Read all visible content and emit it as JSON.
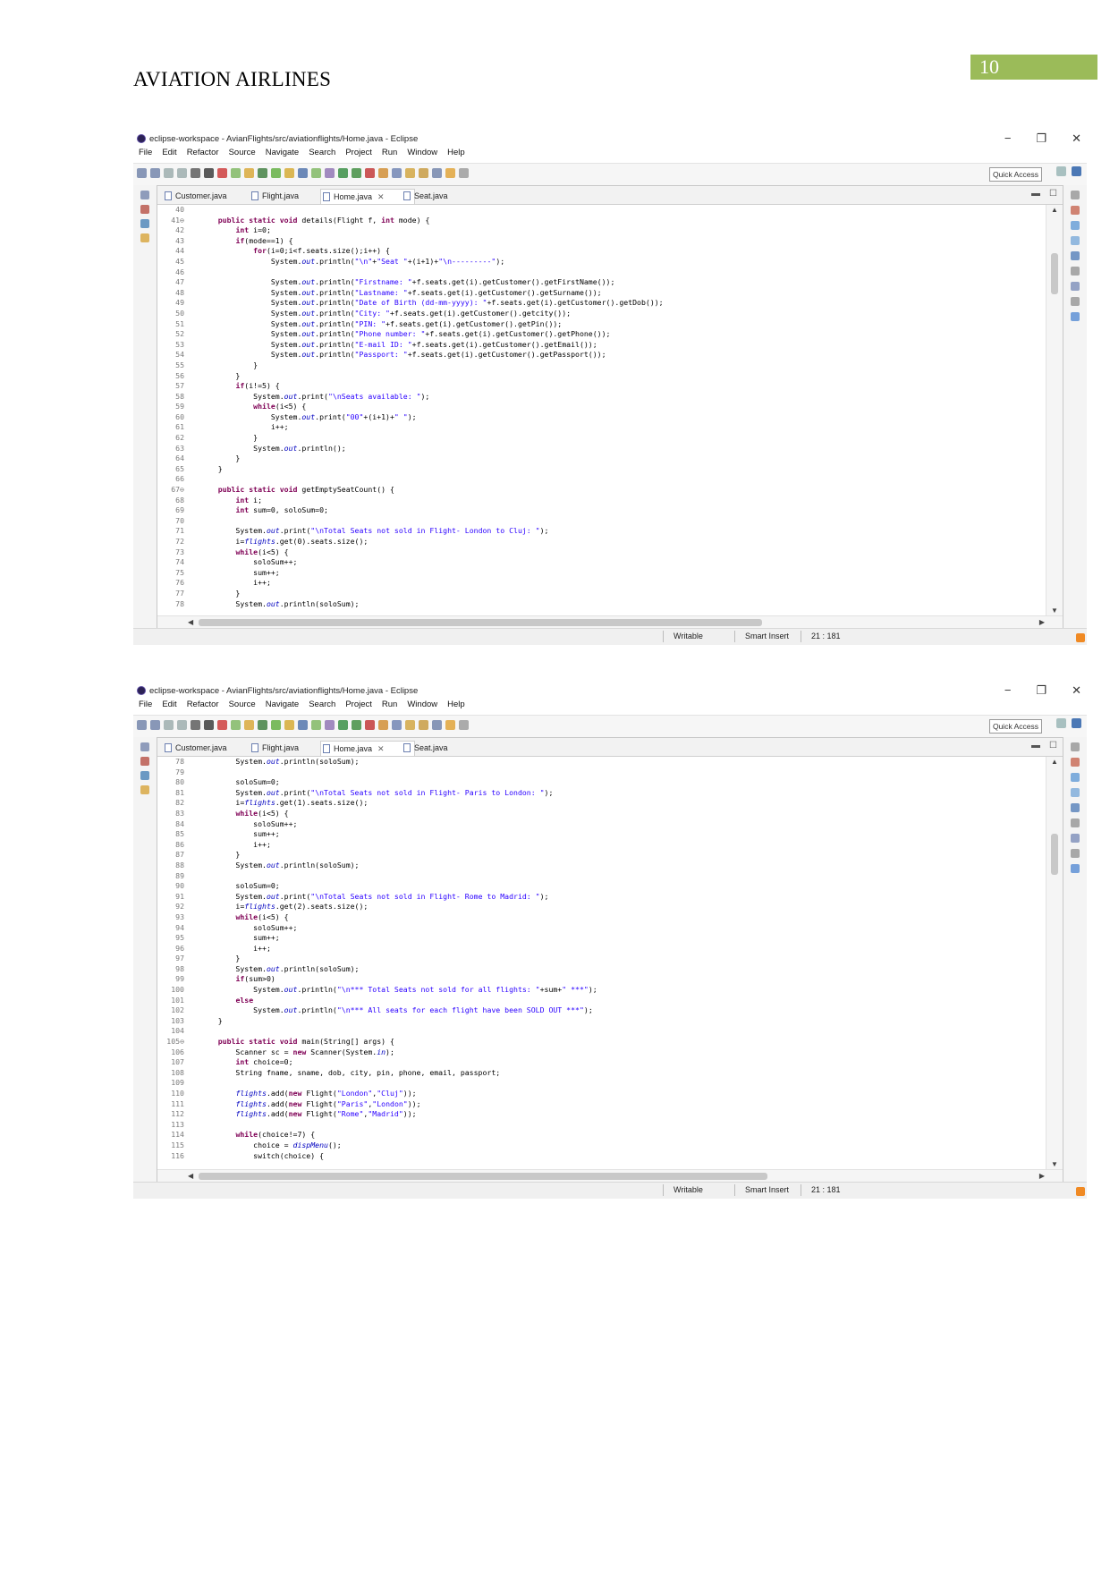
{
  "document": {
    "title": "AVIATION AIRLINES",
    "page_number": "10"
  },
  "screenshots": [
    {
      "window_title": "eclipse-workspace - AvianFlights/src/aviationflights/Home.java - Eclipse",
      "window_buttons": [
        "−",
        "❐",
        "✕"
      ],
      "menu": [
        "File",
        "Edit",
        "Refactor",
        "Source",
        "Navigate",
        "Search",
        "Project",
        "Run",
        "Window",
        "Help"
      ],
      "quick_access": "Quick Access",
      "tabs": [
        {
          "label": "Customer.java",
          "active": false
        },
        {
          "label": "Flight.java",
          "active": false
        },
        {
          "label": "Home.java",
          "active": true
        },
        {
          "label": "Seat.java",
          "active": false
        }
      ],
      "code": [
        {
          "n": "40",
          "t": ""
        },
        {
          "n": "41⊖",
          "t": "    <kw>public</kw> <kw>static</kw> <kw>void</kw> details(Flight f, <kw>int</kw> mode) {"
        },
        {
          "n": "42",
          "t": "        <kw>int</kw> i=0;"
        },
        {
          "n": "43",
          "t": "        <kw>if</kw>(mode==1) {"
        },
        {
          "n": "44",
          "t": "            <kw>for</kw>(i=0;i<f.seats.size();i++) {"
        },
        {
          "n": "45",
          "t": "                System.<fld>out</fld>.println(<str>\"\\n\"</str>+<str>\"Seat \"</str>+(i+1)+<str>\"\\n---------\"</str>);"
        },
        {
          "n": "46",
          "t": ""
        },
        {
          "n": "47",
          "t": "                System.<fld>out</fld>.println(<str>\"Firstname: \"</str>+f.seats.get(i).getCustomer().getFirstName());"
        },
        {
          "n": "48",
          "t": "                System.<fld>out</fld>.println(<str>\"Lastname: \"</str>+f.seats.get(i).getCustomer().getSurname());"
        },
        {
          "n": "49",
          "t": "                System.<fld>out</fld>.println(<str>\"Date of Birth (dd-mm-yyyy): \"</str>+f.seats.get(i).getCustomer().getDob());"
        },
        {
          "n": "50",
          "t": "                System.<fld>out</fld>.println(<str>\"City: \"</str>+f.seats.get(i).getCustomer().getcity());"
        },
        {
          "n": "51",
          "t": "                System.<fld>out</fld>.println(<str>\"PIN: \"</str>+f.seats.get(i).getCustomer().getPin());"
        },
        {
          "n": "52",
          "t": "                System.<fld>out</fld>.println(<str>\"Phone number: \"</str>+f.seats.get(i).getCustomer().getPhone());"
        },
        {
          "n": "53",
          "t": "                System.<fld>out</fld>.println(<str>\"E-mail ID: \"</str>+f.seats.get(i).getCustomer().getEmail());"
        },
        {
          "n": "54",
          "t": "                System.<fld>out</fld>.println(<str>\"Passport: \"</str>+f.seats.get(i).getCustomer().getPassport());"
        },
        {
          "n": "55",
          "t": "            }"
        },
        {
          "n": "56",
          "t": "        }"
        },
        {
          "n": "57",
          "t": "        <kw>if</kw>(i!=5) {"
        },
        {
          "n": "58",
          "t": "            System.<fld>out</fld>.print(<str>\"\\nSeats available: \"</str>);"
        },
        {
          "n": "59",
          "t": "            <kw>while</kw>(i<5) {"
        },
        {
          "n": "60",
          "t": "                System.<fld>out</fld>.print(<str>\"00\"</str>+(i+1)+<str>\" \"</str>);"
        },
        {
          "n": "61",
          "t": "                i++;"
        },
        {
          "n": "62",
          "t": "            }"
        },
        {
          "n": "63",
          "t": "            System.<fld>out</fld>.println();"
        },
        {
          "n": "64",
          "t": "        }"
        },
        {
          "n": "65",
          "t": "    }"
        },
        {
          "n": "66",
          "t": ""
        },
        {
          "n": "67⊖",
          "t": "    <kw>public</kw> <kw>static</kw> <kw>void</kw> getEmptySeatCount() {"
        },
        {
          "n": "68",
          "t": "        <kw>int</kw> i;"
        },
        {
          "n": "69",
          "t": "        <kw>int</kw> sum=0, soloSum=0;"
        },
        {
          "n": "70",
          "t": ""
        },
        {
          "n": "71",
          "t": "        System.<fld>out</fld>.print(<str>\"\\nTotal Seats not sold in Flight- London to Cluj: \"</str>);"
        },
        {
          "n": "72",
          "t": "        i=<fld>flights</fld>.get(0).seats.size();"
        },
        {
          "n": "73",
          "t": "        <kw>while</kw>(i<5) {"
        },
        {
          "n": "74",
          "t": "            soloSum++;"
        },
        {
          "n": "75",
          "t": "            sum++;"
        },
        {
          "n": "76",
          "t": "            i++;"
        },
        {
          "n": "77",
          "t": "        }"
        },
        {
          "n": "78",
          "t": "        System.<fld>out</fld>.println(soloSum);"
        }
      ],
      "status": {
        "writable": "Writable",
        "insert": "Smart Insert",
        "position": "21 : 181"
      }
    },
    {
      "window_title": "eclipse-workspace - AvianFlights/src/aviationflights/Home.java - Eclipse",
      "window_buttons": [
        "−",
        "❐",
        "✕"
      ],
      "menu": [
        "File",
        "Edit",
        "Refactor",
        "Source",
        "Navigate",
        "Search",
        "Project",
        "Run",
        "Window",
        "Help"
      ],
      "quick_access": "Quick Access",
      "tabs": [
        {
          "label": "Customer.java",
          "active": false
        },
        {
          "label": "Flight.java",
          "active": false
        },
        {
          "label": "Home.java",
          "active": true
        },
        {
          "label": "Seat.java",
          "active": false
        }
      ],
      "code": [
        {
          "n": "78",
          "t": "        System.<fld>out</fld>.println(soloSum);"
        },
        {
          "n": "79",
          "t": ""
        },
        {
          "n": "80",
          "t": "        soloSum=0;"
        },
        {
          "n": "81",
          "t": "        System.<fld>out</fld>.print(<str>\"\\nTotal Seats not sold in Flight- Paris to London: \"</str>);"
        },
        {
          "n": "82",
          "t": "        i=<fld>flights</fld>.get(1).seats.size();"
        },
        {
          "n": "83",
          "t": "        <kw>while</kw>(i<5) {"
        },
        {
          "n": "84",
          "t": "            soloSum++;"
        },
        {
          "n": "85",
          "t": "            sum++;"
        },
        {
          "n": "86",
          "t": "            i++;"
        },
        {
          "n": "87",
          "t": "        }"
        },
        {
          "n": "88",
          "t": "        System.<fld>out</fld>.println(soloSum);"
        },
        {
          "n": "89",
          "t": ""
        },
        {
          "n": "90",
          "t": "        soloSum=0;"
        },
        {
          "n": "91",
          "t": "        System.<fld>out</fld>.print(<str>\"\\nTotal Seats not sold in Flight- Rome to Madrid: \"</str>);"
        },
        {
          "n": "92",
          "t": "        i=<fld>flights</fld>.get(2).seats.size();"
        },
        {
          "n": "93",
          "t": "        <kw>while</kw>(i<5) {"
        },
        {
          "n": "94",
          "t": "            soloSum++;"
        },
        {
          "n": "95",
          "t": "            sum++;"
        },
        {
          "n": "96",
          "t": "            i++;"
        },
        {
          "n": "97",
          "t": "        }"
        },
        {
          "n": "98",
          "t": "        System.<fld>out</fld>.println(soloSum);"
        },
        {
          "n": "99",
          "t": "        <kw>if</kw>(sum>0)"
        },
        {
          "n": "100",
          "t": "            System.<fld>out</fld>.println(<str>\"\\n*** Total Seats not sold for all flights: \"</str>+sum+<str>\" ***\"</str>);"
        },
        {
          "n": "101",
          "t": "        <kw>else</kw>"
        },
        {
          "n": "102",
          "t": "            System.<fld>out</fld>.println(<str>\"\\n*** All seats for each flight have been SOLD OUT ***\"</str>);"
        },
        {
          "n": "103",
          "t": "    }"
        },
        {
          "n": "104",
          "t": ""
        },
        {
          "n": "105⊖",
          "t": "    <kw>public</kw> <kw>static</kw> <kw>void</kw> main(String[] args) {"
        },
        {
          "n": "106",
          "t": "        Scanner sc = <kw>new</kw> Scanner(System.<fld>in</fld>);"
        },
        {
          "n": "107",
          "t": "        <kw>int</kw> choice=0;"
        },
        {
          "n": "108",
          "t": "        String fname, sname, dob, city, pin, phone, email, passport;"
        },
        {
          "n": "109",
          "t": ""
        },
        {
          "n": "110",
          "t": "        <fld>flights</fld>.add(<kw>new</kw> Flight(<str>\"London\"</str>,<str>\"Cluj\"</str>));"
        },
        {
          "n": "111",
          "t": "        <fld>flights</fld>.add(<kw>new</kw> Flight(<str>\"Paris\"</str>,<str>\"London\"</str>));"
        },
        {
          "n": "112",
          "t": "        <fld>flights</fld>.add(<kw>new</kw> Flight(<str>\"Rome\"</str>,<str>\"Madrid\"</str>));"
        },
        {
          "n": "113",
          "t": ""
        },
        {
          "n": "114",
          "t": "        <kw>while</kw>(choice!=7) {"
        },
        {
          "n": "115",
          "t": "            choice = <fld>dispMenu</fld>();"
        },
        {
          "n": "116",
          "t": "            switch(choice) {"
        }
      ],
      "status": {
        "writable": "Writable",
        "insert": "Smart Insert",
        "position": "21 : 181"
      }
    }
  ]
}
